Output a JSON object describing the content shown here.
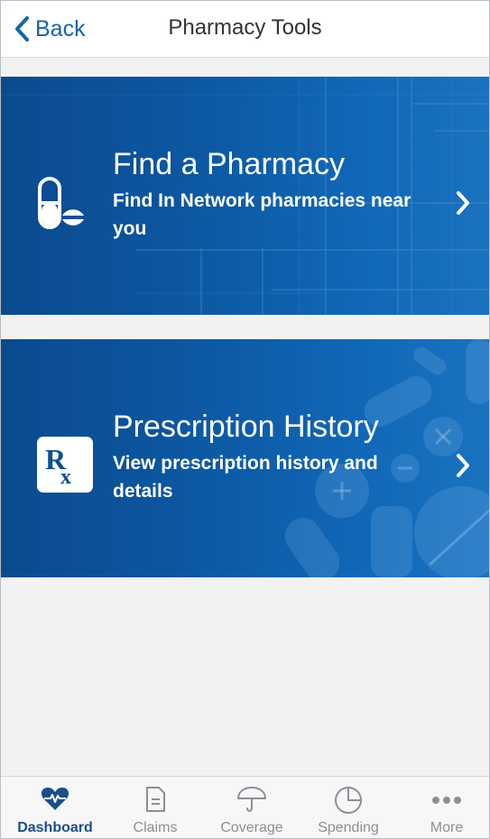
{
  "header": {
    "back_label": "Back",
    "title": "Pharmacy Tools"
  },
  "cards": [
    {
      "title": "Find a Pharmacy",
      "description": "Find In Network pharmacies near you",
      "icon": "pill-icon"
    },
    {
      "title": "Prescription History",
      "description": "View prescription history and details",
      "icon": "rx-icon"
    }
  ],
  "tabs": [
    {
      "label": "Dashboard",
      "icon": "heart-pulse-icon",
      "active": true
    },
    {
      "label": "Claims",
      "icon": "document-icon",
      "active": false
    },
    {
      "label": "Coverage",
      "icon": "umbrella-icon",
      "active": false
    },
    {
      "label": "Spending",
      "icon": "pie-chart-icon",
      "active": false
    },
    {
      "label": "More",
      "icon": "more-dots-icon",
      "active": false
    }
  ],
  "colors": {
    "accent": "#1565a6",
    "card_blue": "#0d5aa5",
    "tab_active": "#1b4f8a",
    "tab_inactive": "#8a8f96"
  }
}
